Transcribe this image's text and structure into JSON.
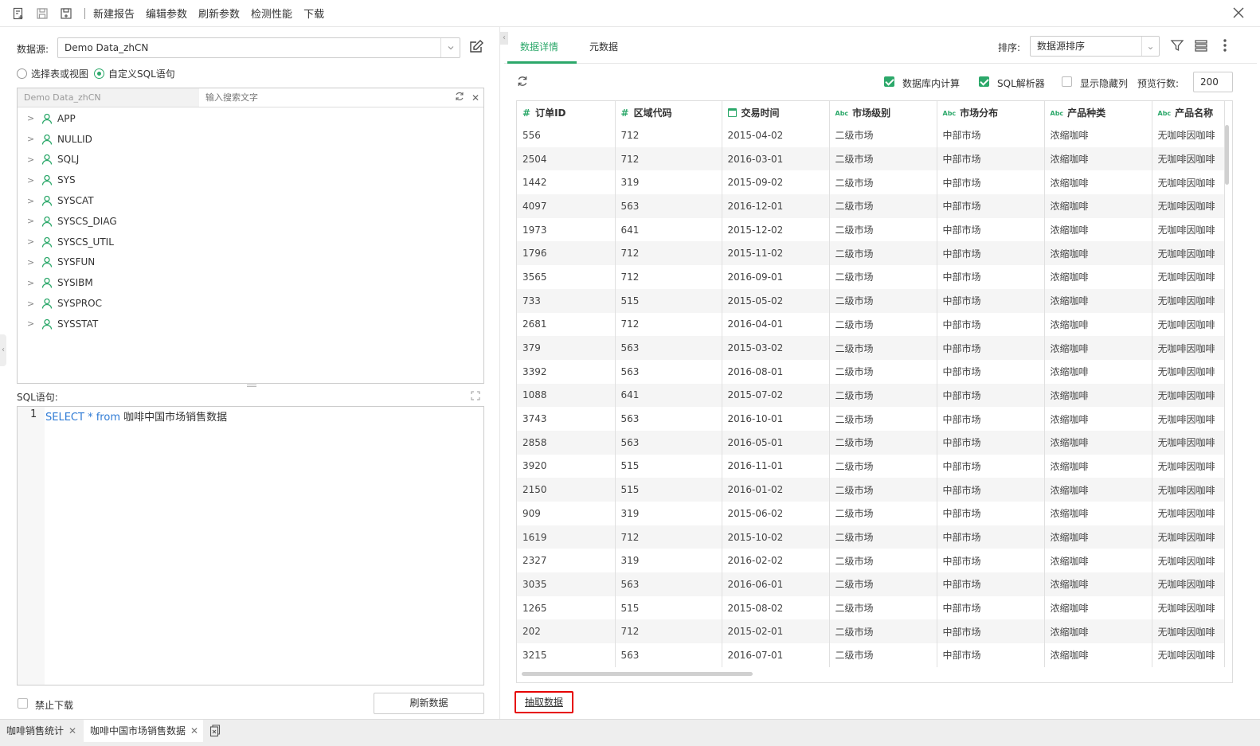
{
  "toolbar": {
    "buttons": [
      "新建报告",
      "编辑参数",
      "刷新参数",
      "检测性能",
      "下载"
    ]
  },
  "left": {
    "datasource_label": "数据源:",
    "datasource_value": "Demo Data_zhCN",
    "radio_table": "选择表或视图",
    "radio_sql": "自定义SQL语句",
    "tree_source": "Demo Data_zhCN",
    "tree_search_placeholder": "输入搜索文字",
    "schemas": [
      "APP",
      "NULLID",
      "SQLJ",
      "SYS",
      "SYSCAT",
      "SYSCS_DIAG",
      "SYSCS_UTIL",
      "SYSFUN",
      "SYSIBM",
      "SYSPROC",
      "SYSSTAT"
    ],
    "sql_label": "SQL语句:",
    "sql_line_number": "1",
    "sql_keyword_select": "SELECT",
    "sql_star": "*",
    "sql_keyword_from": "from",
    "sql_table": "咖啡中国市场销售数据",
    "disable_download": "禁止下载",
    "refresh_button": "刷新数据"
  },
  "right": {
    "tab_detail": "数据详情",
    "tab_meta": "元数据",
    "sort_label": "排序:",
    "sort_value": "数据源排序",
    "db_compute": "数据库内计算",
    "sql_parser": "SQL解析器",
    "show_hidden": "显示隐藏列",
    "preview_label": "预览行数:",
    "preview_value": "200",
    "extract_button": "抽取数据",
    "columns": [
      {
        "type": "num",
        "name": "订单ID"
      },
      {
        "type": "num",
        "name": "区域代码"
      },
      {
        "type": "date",
        "name": "交易时间"
      },
      {
        "type": "abc",
        "name": "市场级别"
      },
      {
        "type": "abc",
        "name": "市场分布"
      },
      {
        "type": "abc",
        "name": "产品种类"
      },
      {
        "type": "abc",
        "name": "产品名称"
      }
    ],
    "abc_tag": "Abc",
    "num_tag": "#",
    "rows": [
      [
        "556",
        "712",
        "2015-04-02",
        "二级市场",
        "中部市场",
        "浓缩咖啡",
        "无咖啡因咖啡"
      ],
      [
        "2504",
        "712",
        "2016-03-01",
        "二级市场",
        "中部市场",
        "浓缩咖啡",
        "无咖啡因咖啡"
      ],
      [
        "1442",
        "319",
        "2015-09-02",
        "二级市场",
        "中部市场",
        "浓缩咖啡",
        "无咖啡因咖啡"
      ],
      [
        "4097",
        "563",
        "2016-12-01",
        "二级市场",
        "中部市场",
        "浓缩咖啡",
        "无咖啡因咖啡"
      ],
      [
        "1973",
        "641",
        "2015-12-02",
        "二级市场",
        "中部市场",
        "浓缩咖啡",
        "无咖啡因咖啡"
      ],
      [
        "1796",
        "712",
        "2015-11-02",
        "二级市场",
        "中部市场",
        "浓缩咖啡",
        "无咖啡因咖啡"
      ],
      [
        "3565",
        "712",
        "2016-09-01",
        "二级市场",
        "中部市场",
        "浓缩咖啡",
        "无咖啡因咖啡"
      ],
      [
        "733",
        "515",
        "2015-05-02",
        "二级市场",
        "中部市场",
        "浓缩咖啡",
        "无咖啡因咖啡"
      ],
      [
        "2681",
        "712",
        "2016-04-01",
        "二级市场",
        "中部市场",
        "浓缩咖啡",
        "无咖啡因咖啡"
      ],
      [
        "379",
        "563",
        "2015-03-02",
        "二级市场",
        "中部市场",
        "浓缩咖啡",
        "无咖啡因咖啡"
      ],
      [
        "3392",
        "563",
        "2016-08-01",
        "二级市场",
        "中部市场",
        "浓缩咖啡",
        "无咖啡因咖啡"
      ],
      [
        "1088",
        "641",
        "2015-07-02",
        "二级市场",
        "中部市场",
        "浓缩咖啡",
        "无咖啡因咖啡"
      ],
      [
        "3743",
        "563",
        "2016-10-01",
        "二级市场",
        "中部市场",
        "浓缩咖啡",
        "无咖啡因咖啡"
      ],
      [
        "2858",
        "563",
        "2016-05-01",
        "二级市场",
        "中部市场",
        "浓缩咖啡",
        "无咖啡因咖啡"
      ],
      [
        "3920",
        "515",
        "2016-11-01",
        "二级市场",
        "中部市场",
        "浓缩咖啡",
        "无咖啡因咖啡"
      ],
      [
        "2150",
        "515",
        "2016-01-02",
        "二级市场",
        "中部市场",
        "浓缩咖啡",
        "无咖啡因咖啡"
      ],
      [
        "909",
        "319",
        "2015-06-02",
        "二级市场",
        "中部市场",
        "浓缩咖啡",
        "无咖啡因咖啡"
      ],
      [
        "1619",
        "712",
        "2015-10-02",
        "二级市场",
        "中部市场",
        "浓缩咖啡",
        "无咖啡因咖啡"
      ],
      [
        "2327",
        "319",
        "2016-02-02",
        "二级市场",
        "中部市场",
        "浓缩咖啡",
        "无咖啡因咖啡"
      ],
      [
        "3035",
        "563",
        "2016-06-01",
        "二级市场",
        "中部市场",
        "浓缩咖啡",
        "无咖啡因咖啡"
      ],
      [
        "1265",
        "515",
        "2015-08-02",
        "二级市场",
        "中部市场",
        "浓缩咖啡",
        "无咖啡因咖啡"
      ],
      [
        "202",
        "712",
        "2015-02-01",
        "二级市场",
        "中部市场",
        "浓缩咖啡",
        "无咖啡因咖啡"
      ],
      [
        "3215",
        "563",
        "2016-07-01",
        "二级市场",
        "中部市场",
        "浓缩咖啡",
        "无咖啡因咖啡"
      ]
    ]
  },
  "bottom_tabs": [
    "咖啡销售统计",
    "咖啡中国市场销售数据"
  ],
  "colors": {
    "accent": "#2ca86a",
    "highlight_border": "#e60000"
  }
}
